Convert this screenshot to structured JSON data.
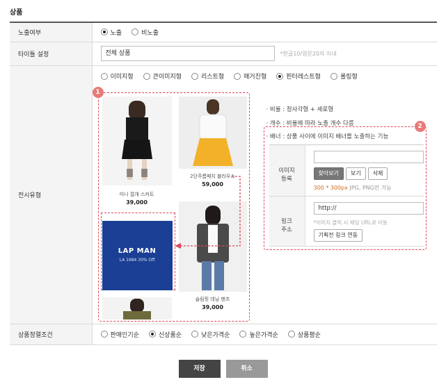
{
  "section_title": "상품",
  "rows": {
    "exposure": {
      "label": "노출여부",
      "options": [
        "노출",
        "비노출"
      ],
      "selected": 0
    },
    "title_setting": {
      "label": "타이틀 설정",
      "value": "전체 상품",
      "hint": "*한글10/영문20자 이내"
    },
    "display_type": {
      "label": "전시유형",
      "options": [
        "이미지형",
        "큰이미지형",
        "리스트형",
        "매거진형",
        "핀터레스트형",
        "롤링형"
      ],
      "selected": 4
    },
    "sort": {
      "label": "상품정렬조건",
      "options": [
        "판매인기순",
        "신상품순",
        "낮은가격순",
        "높은가격순",
        "상품평순"
      ],
      "selected": 1
    }
  },
  "preview": {
    "badge1": "1",
    "badge2": "2",
    "products": [
      {
        "name": "미니 절개 스커트",
        "price": "39,000"
      },
      {
        "name": "2단주름패치 블라우스",
        "price": "59,000"
      },
      {
        "name": "슬림핏 데님 팬츠",
        "price": "39,000"
      }
    ],
    "banner": {
      "title": "LAP MAN",
      "subtitle": "LA 1984 30% Off"
    }
  },
  "info": {
    "ratio": "· 비율 : 정사각형 + 세로형",
    "count": "· 개수 : 비율에 따라 노출 개수 다름",
    "banner": "· 배너 : 상품 사이에 이미지 배너를 노출하는 기능"
  },
  "banner_form": {
    "image_label_1": "이미지",
    "image_label_2": "등록",
    "browse": "찾아보기",
    "view": "보기",
    "delete": "삭제",
    "size_px": "300 * 300px",
    "size_note": "JPG, PNG만 가능",
    "link_label_1": "링크",
    "link_label_2": "주소",
    "url_value": "http://",
    "link_hint": "*이미지 클릭 시 해당 URL로 이동",
    "exhibition_link": "기획전 링크 연동"
  },
  "buttons": {
    "save": "저장",
    "cancel": "취소"
  },
  "colors": {
    "dash": "#e0465a",
    "badge": "#e87a78",
    "banner": "#1a3f94",
    "save": "#444444",
    "cancel": "#999999"
  }
}
